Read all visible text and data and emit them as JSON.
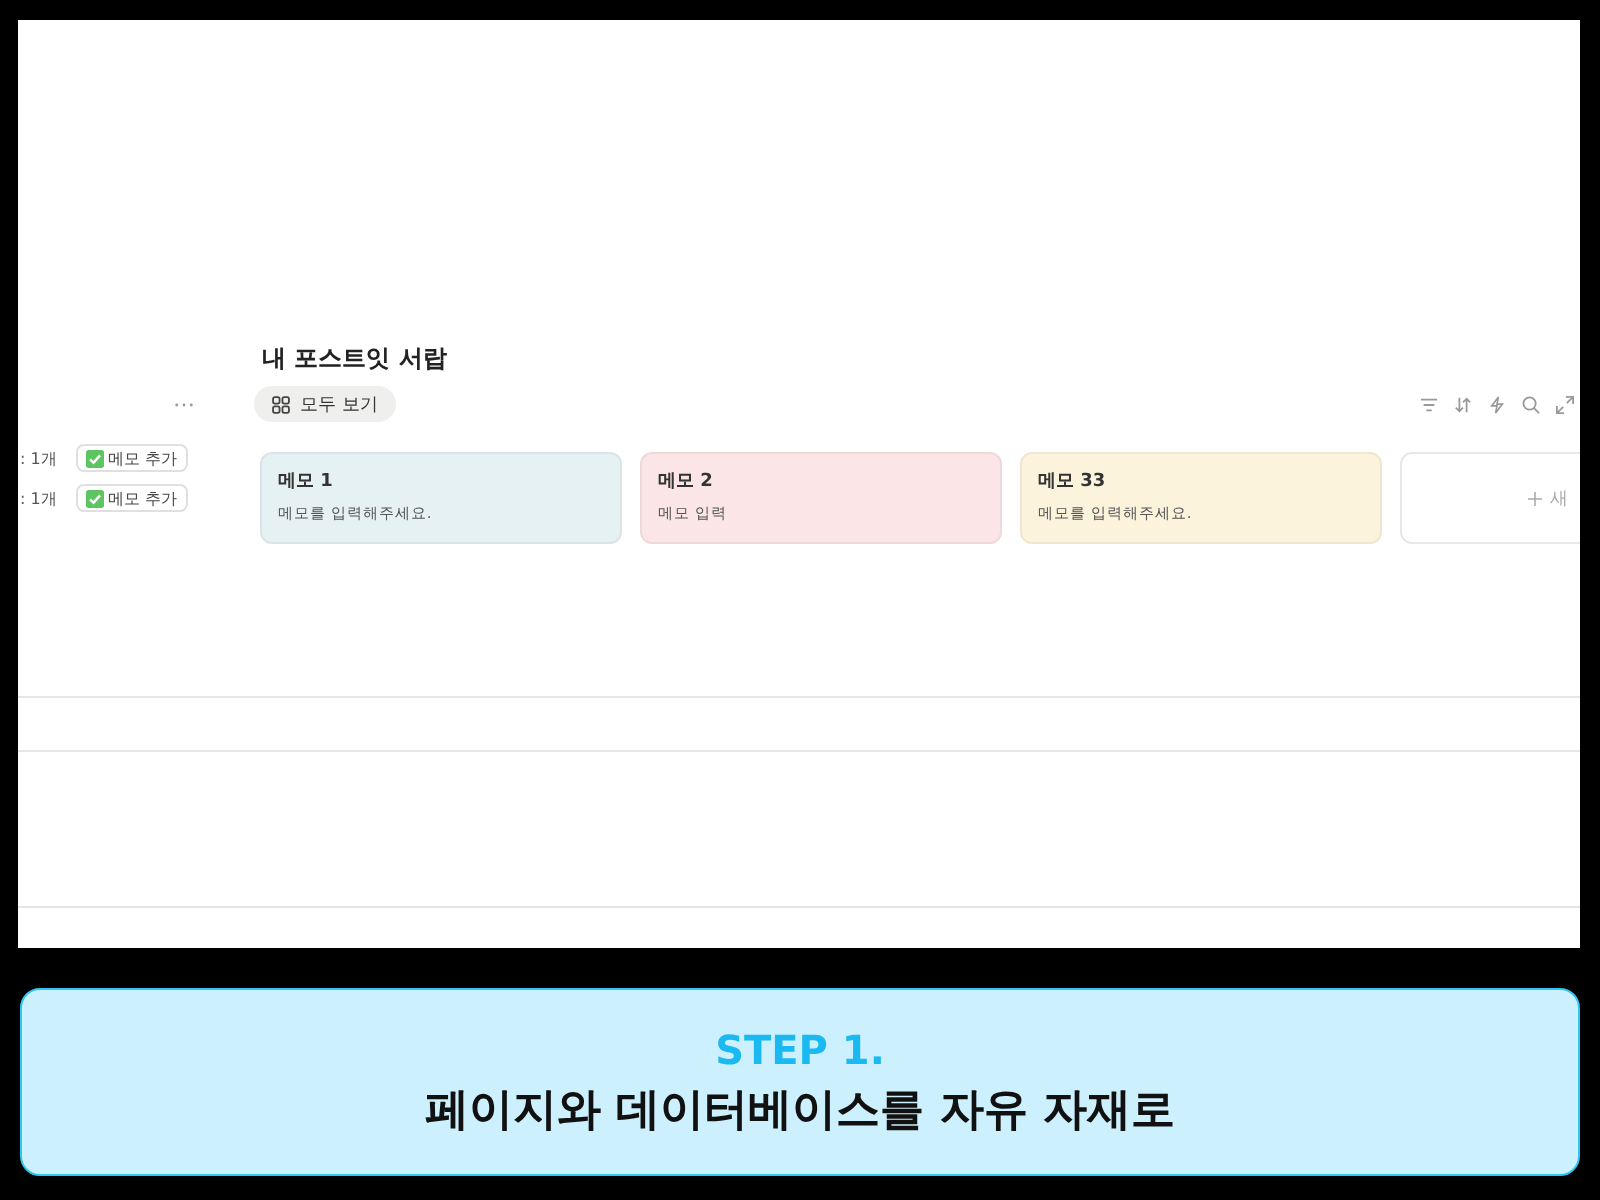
{
  "page": {
    "title": "내 포스트잇 서랍",
    "view_tab": {
      "label": "모두 보기",
      "selected": true
    }
  },
  "side_rows": [
    {
      "count": ": 1개",
      "button": "메모 추가"
    },
    {
      "count": ": 1개",
      "button": "메모 추가"
    }
  ],
  "cards": [
    {
      "title": "메모 1",
      "body": "메모를 입력해주세요.",
      "color": "#e6f1f4"
    },
    {
      "title": "메모 2",
      "body": "메모 입력",
      "color": "#fbe5e6"
    },
    {
      "title": "메모 33",
      "body": "메모를 입력해주세요.",
      "color": "#fbf3db"
    }
  ],
  "new_card": {
    "label": "새"
  },
  "caption": {
    "step": "STEP 1.",
    "headline": "페이지와 데이터베이스를 자유 자재로"
  }
}
